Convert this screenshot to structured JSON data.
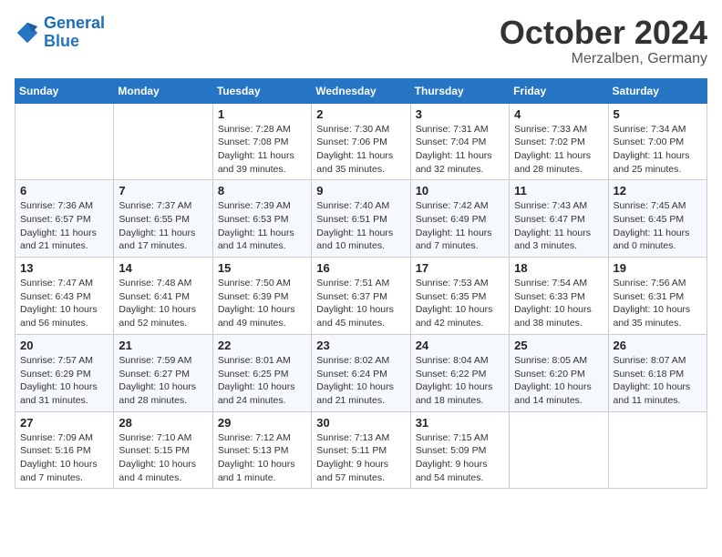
{
  "header": {
    "logo_line1": "General",
    "logo_line2": "Blue",
    "month": "October 2024",
    "location": "Merzalben, Germany"
  },
  "weekdays": [
    "Sunday",
    "Monday",
    "Tuesday",
    "Wednesday",
    "Thursday",
    "Friday",
    "Saturday"
  ],
  "weeks": [
    [
      {
        "day": "",
        "info": ""
      },
      {
        "day": "",
        "info": ""
      },
      {
        "day": "1",
        "info": "Sunrise: 7:28 AM\nSunset: 7:08 PM\nDaylight: 11 hours and 39 minutes."
      },
      {
        "day": "2",
        "info": "Sunrise: 7:30 AM\nSunset: 7:06 PM\nDaylight: 11 hours and 35 minutes."
      },
      {
        "day": "3",
        "info": "Sunrise: 7:31 AM\nSunset: 7:04 PM\nDaylight: 11 hours and 32 minutes."
      },
      {
        "day": "4",
        "info": "Sunrise: 7:33 AM\nSunset: 7:02 PM\nDaylight: 11 hours and 28 minutes."
      },
      {
        "day": "5",
        "info": "Sunrise: 7:34 AM\nSunset: 7:00 PM\nDaylight: 11 hours and 25 minutes."
      }
    ],
    [
      {
        "day": "6",
        "info": "Sunrise: 7:36 AM\nSunset: 6:57 PM\nDaylight: 11 hours and 21 minutes."
      },
      {
        "day": "7",
        "info": "Sunrise: 7:37 AM\nSunset: 6:55 PM\nDaylight: 11 hours and 17 minutes."
      },
      {
        "day": "8",
        "info": "Sunrise: 7:39 AM\nSunset: 6:53 PM\nDaylight: 11 hours and 14 minutes."
      },
      {
        "day": "9",
        "info": "Sunrise: 7:40 AM\nSunset: 6:51 PM\nDaylight: 11 hours and 10 minutes."
      },
      {
        "day": "10",
        "info": "Sunrise: 7:42 AM\nSunset: 6:49 PM\nDaylight: 11 hours and 7 minutes."
      },
      {
        "day": "11",
        "info": "Sunrise: 7:43 AM\nSunset: 6:47 PM\nDaylight: 11 hours and 3 minutes."
      },
      {
        "day": "12",
        "info": "Sunrise: 7:45 AM\nSunset: 6:45 PM\nDaylight: 11 hours and 0 minutes."
      }
    ],
    [
      {
        "day": "13",
        "info": "Sunrise: 7:47 AM\nSunset: 6:43 PM\nDaylight: 10 hours and 56 minutes."
      },
      {
        "day": "14",
        "info": "Sunrise: 7:48 AM\nSunset: 6:41 PM\nDaylight: 10 hours and 52 minutes."
      },
      {
        "day": "15",
        "info": "Sunrise: 7:50 AM\nSunset: 6:39 PM\nDaylight: 10 hours and 49 minutes."
      },
      {
        "day": "16",
        "info": "Sunrise: 7:51 AM\nSunset: 6:37 PM\nDaylight: 10 hours and 45 minutes."
      },
      {
        "day": "17",
        "info": "Sunrise: 7:53 AM\nSunset: 6:35 PM\nDaylight: 10 hours and 42 minutes."
      },
      {
        "day": "18",
        "info": "Sunrise: 7:54 AM\nSunset: 6:33 PM\nDaylight: 10 hours and 38 minutes."
      },
      {
        "day": "19",
        "info": "Sunrise: 7:56 AM\nSunset: 6:31 PM\nDaylight: 10 hours and 35 minutes."
      }
    ],
    [
      {
        "day": "20",
        "info": "Sunrise: 7:57 AM\nSunset: 6:29 PM\nDaylight: 10 hours and 31 minutes."
      },
      {
        "day": "21",
        "info": "Sunrise: 7:59 AM\nSunset: 6:27 PM\nDaylight: 10 hours and 28 minutes."
      },
      {
        "day": "22",
        "info": "Sunrise: 8:01 AM\nSunset: 6:25 PM\nDaylight: 10 hours and 24 minutes."
      },
      {
        "day": "23",
        "info": "Sunrise: 8:02 AM\nSunset: 6:24 PM\nDaylight: 10 hours and 21 minutes."
      },
      {
        "day": "24",
        "info": "Sunrise: 8:04 AM\nSunset: 6:22 PM\nDaylight: 10 hours and 18 minutes."
      },
      {
        "day": "25",
        "info": "Sunrise: 8:05 AM\nSunset: 6:20 PM\nDaylight: 10 hours and 14 minutes."
      },
      {
        "day": "26",
        "info": "Sunrise: 8:07 AM\nSunset: 6:18 PM\nDaylight: 10 hours and 11 minutes."
      }
    ],
    [
      {
        "day": "27",
        "info": "Sunrise: 7:09 AM\nSunset: 5:16 PM\nDaylight: 10 hours and 7 minutes."
      },
      {
        "day": "28",
        "info": "Sunrise: 7:10 AM\nSunset: 5:15 PM\nDaylight: 10 hours and 4 minutes."
      },
      {
        "day": "29",
        "info": "Sunrise: 7:12 AM\nSunset: 5:13 PM\nDaylight: 10 hours and 1 minute."
      },
      {
        "day": "30",
        "info": "Sunrise: 7:13 AM\nSunset: 5:11 PM\nDaylight: 9 hours and 57 minutes."
      },
      {
        "day": "31",
        "info": "Sunrise: 7:15 AM\nSunset: 5:09 PM\nDaylight: 9 hours and 54 minutes."
      },
      {
        "day": "",
        "info": ""
      },
      {
        "day": "",
        "info": ""
      }
    ]
  ]
}
